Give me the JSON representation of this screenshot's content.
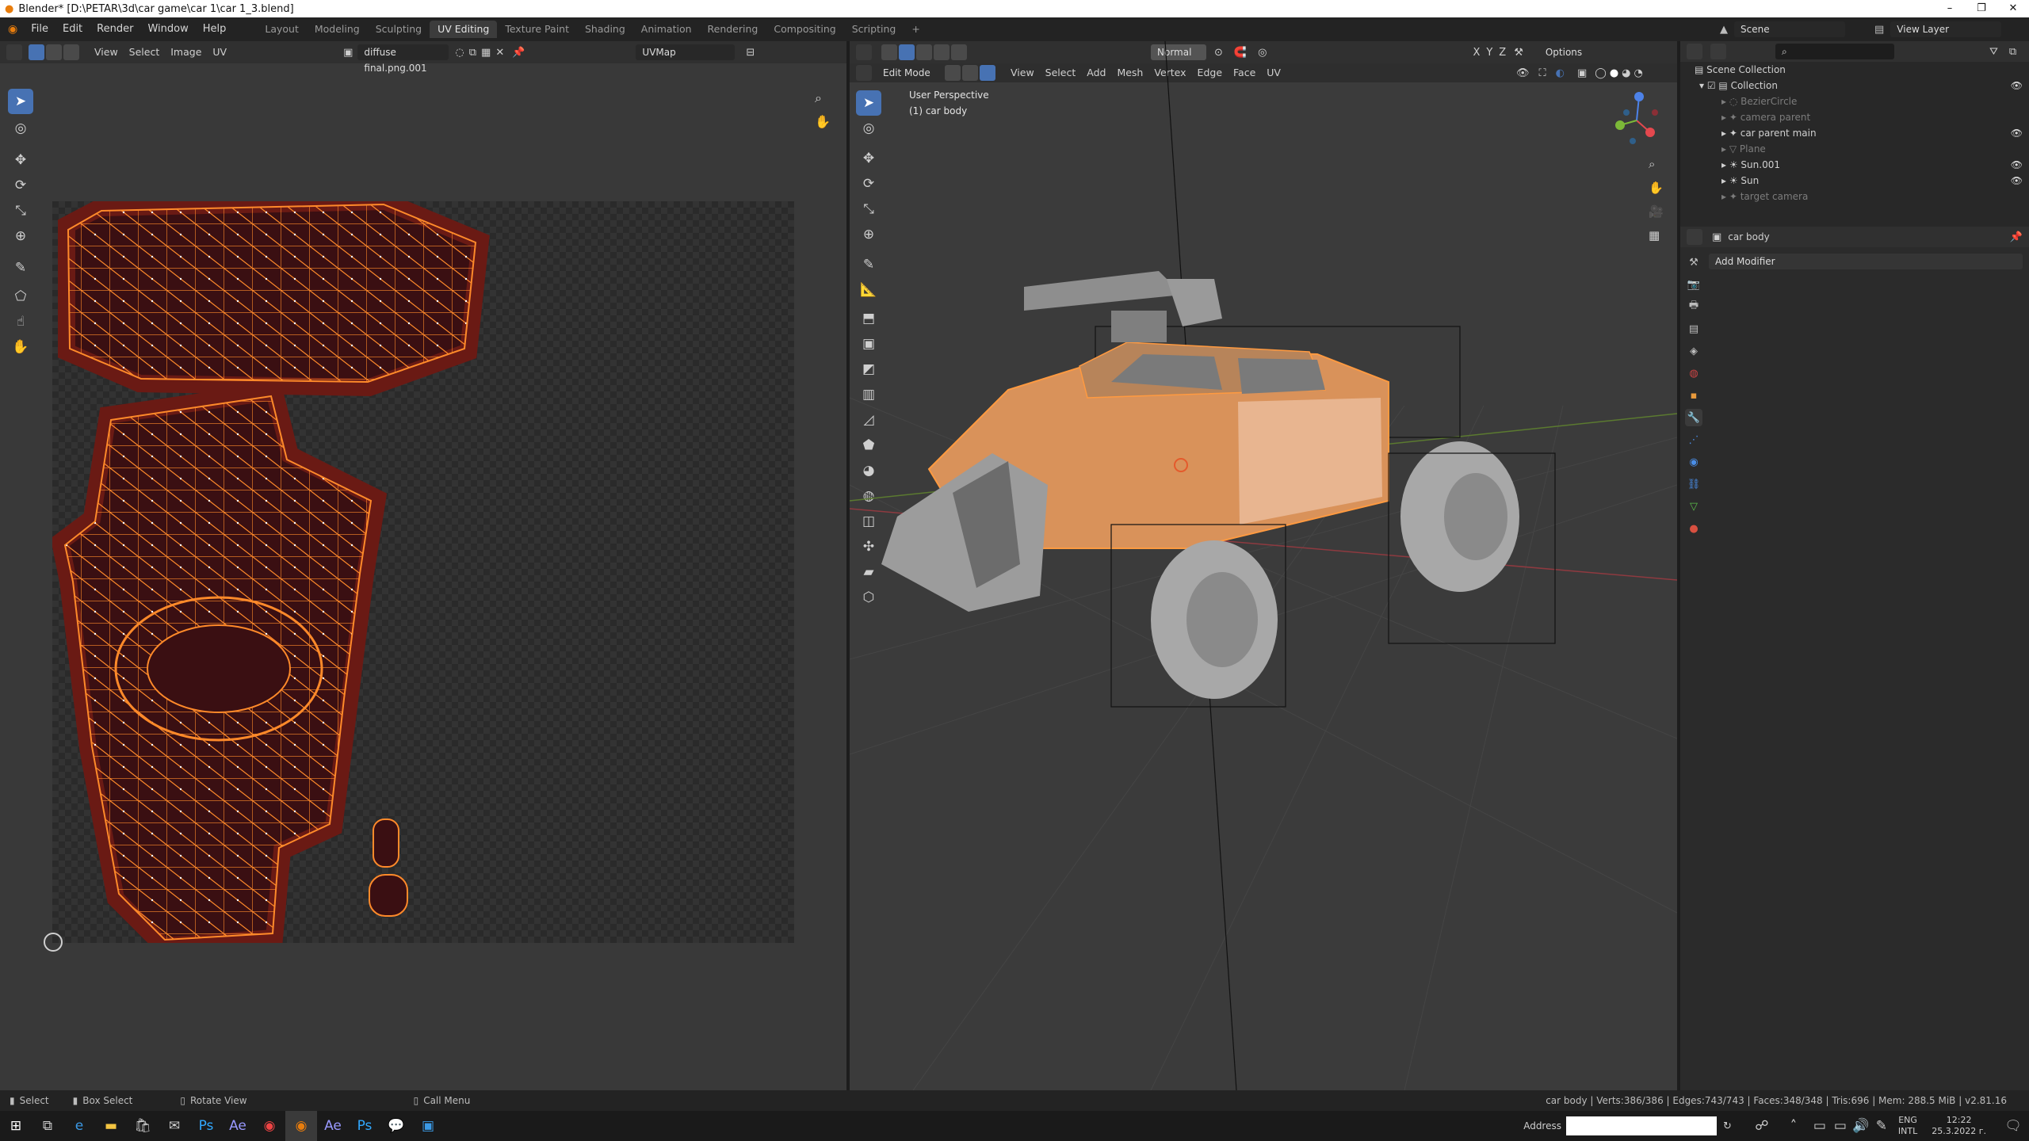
{
  "window": {
    "title": "Blender* [D:\\PETAR\\3d\\car game\\car 1\\car 1_3.blend]",
    "min": "–",
    "max": "❐",
    "close": "✕"
  },
  "menu": [
    "File",
    "Edit",
    "Render",
    "Window",
    "Help"
  ],
  "workspaces": [
    "Layout",
    "Modeling",
    "Sculpting",
    "UV Editing",
    "Texture Paint",
    "Shading",
    "Animation",
    "Rendering",
    "Compositing",
    "Scripting"
  ],
  "add_tab": "+",
  "scene": {
    "label": "Scene",
    "view_layer": "View Layer"
  },
  "uv": {
    "menus": [
      "View",
      "Select",
      "Image",
      "UV"
    ],
    "image_name": "diffuse final.png.001",
    "uvmap": "UVMap"
  },
  "viewport": {
    "mode": "Edit Mode",
    "menus": [
      "View",
      "Select",
      "Add",
      "Mesh",
      "Vertex",
      "Edge",
      "Face",
      "UV"
    ],
    "orientation": "Normal",
    "options": "Options",
    "view_name": "User Perspective",
    "object_line": "(1) car body"
  },
  "outliner": {
    "root": "Scene Collection",
    "collection": "Collection",
    "items": [
      "BezierCircle",
      "camera parent",
      "car parent main",
      "Plane",
      "Sun.001",
      "Sun",
      "target camera"
    ]
  },
  "properties": {
    "object": "car body",
    "add_modifier": "Add Modifier"
  },
  "status": {
    "select": "Select",
    "box_select": "Box Select",
    "rotate": "Rotate View",
    "call_menu": "Call Menu",
    "stats": "car body | Verts:386/386 | Edges:743/743 | Faces:348/348 | Tris:696 | Mem: 288.5 MiB | v2.81.16"
  },
  "taskbar": {
    "address_label": "Address",
    "lang1": "ENG",
    "lang2": "INTL",
    "time": "12:22",
    "date": "25.3.2022 г."
  },
  "colors": {
    "accent": "#4772b3",
    "uv_orange": "#ff8a2a",
    "uv_dark": "#3a0f12",
    "car_body": "#e8a16a",
    "selected_row": "#334d80"
  }
}
